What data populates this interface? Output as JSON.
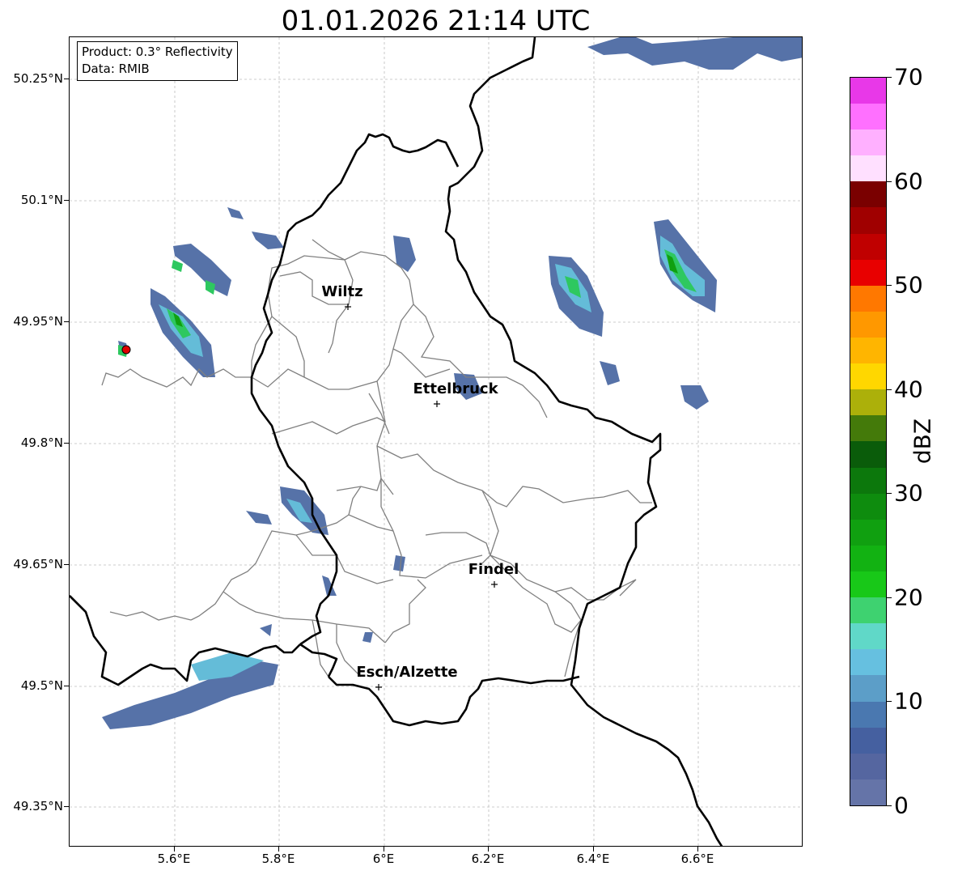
{
  "title": "01.01.2026 21:14 UTC",
  "info_box": {
    "product": "Product: 0.3° Reflectivity",
    "data_source": "Data: RMIB"
  },
  "axes": {
    "lat_ticks": [
      "50.25°N",
      "50.1°N",
      "49.95°N",
      "49.8°N",
      "49.65°N",
      "49.5°N",
      "49.35°N"
    ],
    "lon_ticks": [
      "5.6°E",
      "5.8°E",
      "6°E",
      "6.2°E",
      "6.4°E",
      "6.6°E"
    ]
  },
  "cities": [
    "Wiltz",
    "Ettelbruck",
    "Findel",
    "Esch/Alzette"
  ],
  "colorbar": {
    "label": "dBZ",
    "ticks": [
      "0",
      "10",
      "20",
      "30",
      "40",
      "50",
      "60",
      "70"
    ],
    "colors": [
      "#6574a8",
      "#5566a0",
      "#4560a0",
      "#4a78b0",
      "#5c9ec8",
      "#66c0e0",
      "#60d8c8",
      "#3ed270",
      "#18c818",
      "#12b212",
      "#10a010",
      "#0e8c0e",
      "#0c780c",
      "#0a5c0a",
      "#447a0a",
      "#acb00a",
      "#ffd700",
      "#ffb500",
      "#ff9800",
      "#ff7800",
      "#e80000",
      "#c00000",
      "#a00000",
      "#7a0000",
      "#ffe0ff",
      "#ffb0ff",
      "#ff70ff",
      "#e838e8"
    ]
  },
  "colors": {
    "border": "#000000",
    "canton": "#808080",
    "grid": "#bdbdbd",
    "radar_site": "#e00000"
  }
}
